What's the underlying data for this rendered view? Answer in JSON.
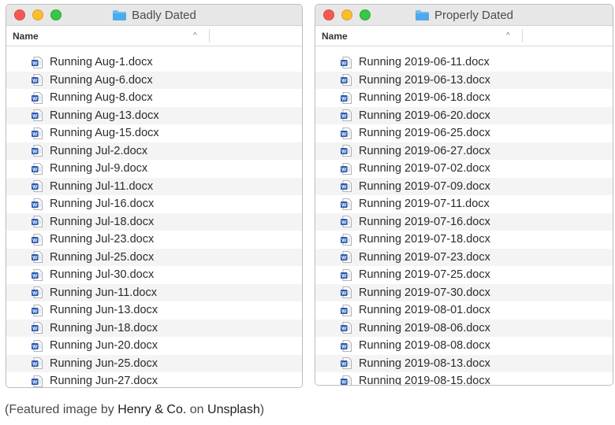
{
  "left_window": {
    "title": "Badly Dated",
    "column_header": "Name",
    "sort_indicator": "^",
    "files": [
      "Running Aug-1.docx",
      "Running Aug-6.docx",
      "Running Aug-8.docx",
      "Running Aug-13.docx",
      "Running Aug-15.docx",
      "Running Jul-2.docx",
      "Running Jul-9.docx",
      "Running Jul-11.docx",
      "Running Jul-16.docx",
      "Running Jul-18.docx",
      "Running Jul-23.docx",
      "Running Jul-25.docx",
      "Running Jul-30.docx",
      "Running Jun-11.docx",
      "Running Jun-13.docx",
      "Running Jun-18.docx",
      "Running Jun-20.docx",
      "Running Jun-25.docx",
      "Running Jun-27.docx"
    ]
  },
  "right_window": {
    "title": "Properly Dated",
    "column_header": "Name",
    "sort_indicator": "^",
    "files": [
      "Running 2019-06-11.docx",
      "Running 2019-06-13.docx",
      "Running 2019-06-18.docx",
      "Running 2019-06-20.docx",
      "Running 2019-06-25.docx",
      "Running 2019-06-27.docx",
      "Running 2019-07-02.docx",
      "Running 2019-07-09.docx",
      "Running 2019-07-11.docx",
      "Running 2019-07-16.docx",
      "Running 2019-07-18.docx",
      "Running 2019-07-23.docx",
      "Running 2019-07-25.docx",
      "Running 2019-07-30.docx",
      "Running 2019-08-01.docx",
      "Running 2019-08-06.docx",
      "Running 2019-08-08.docx",
      "Running 2019-08-13.docx",
      "Running 2019-08-15.docx"
    ]
  },
  "caption": {
    "prefix": "(Featured image by ",
    "author": "Henry & Co.",
    "middle": " on ",
    "site": "Unsplash",
    "suffix": ")"
  },
  "icons": {
    "file": "word-document-icon",
    "folder": "folder-icon"
  },
  "colors": {
    "close": "#f45a52",
    "minimize": "#f9bd2e",
    "zoom": "#3ac648",
    "folder": "#5ab4f0",
    "word_blue": "#2a5ab0"
  }
}
